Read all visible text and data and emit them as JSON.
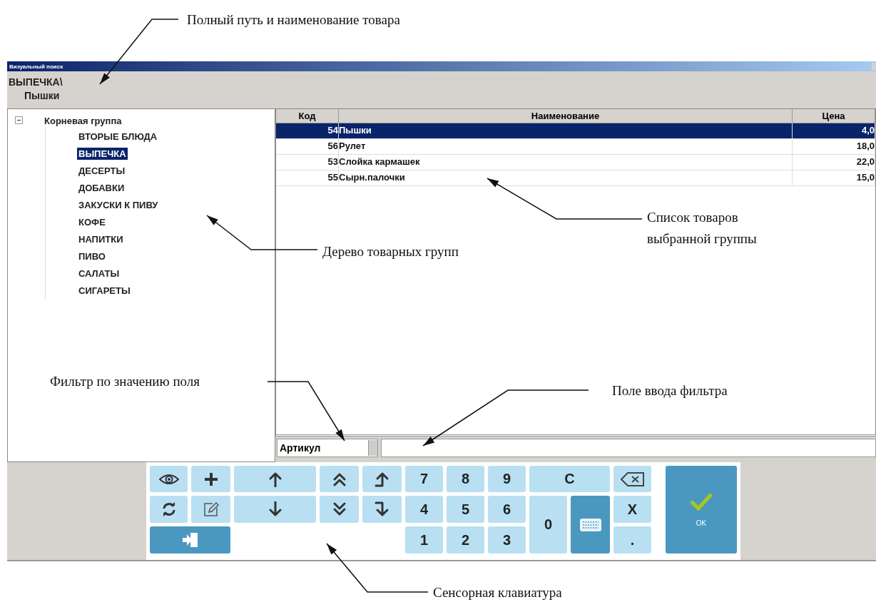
{
  "window": {
    "title": "Визуальный поиск"
  },
  "path": [
    "ВЫПЕЧКА\\",
    "Пышки"
  ],
  "tree": {
    "label": "Корневая группа",
    "expanded": true,
    "children": [
      {
        "label": "ВТОРЫЕ БЛЮДА",
        "selected": false
      },
      {
        "label": "ВЫПЕЧКА",
        "selected": true
      },
      {
        "label": "ДЕСЕРТЫ",
        "selected": false
      },
      {
        "label": "ДОБАВКИ",
        "selected": false
      },
      {
        "label": "ЗАКУСКИ К ПИВУ",
        "selected": false
      },
      {
        "label": "КОФЕ",
        "selected": false
      },
      {
        "label": "НАПИТКИ",
        "selected": false
      },
      {
        "label": "ПИВО",
        "selected": false
      },
      {
        "label": "САЛАТЫ",
        "selected": false
      },
      {
        "label": "СИГАРЕТЫ",
        "selected": false
      }
    ]
  },
  "table": {
    "columns": [
      "Код",
      "Наименование",
      "Цена"
    ],
    "rows": [
      {
        "cells": [
          "54",
          "Пышки",
          "4,0"
        ],
        "selected": true
      },
      {
        "cells": [
          "56",
          "Рулет",
          "18,0"
        ],
        "selected": false
      },
      {
        "cells": [
          "53",
          "Слойка кармашек",
          "22,0"
        ],
        "selected": false
      },
      {
        "cells": [
          "55",
          "Сырн.палочки",
          "15,0"
        ],
        "selected": false
      }
    ]
  },
  "filter": {
    "field": "Артикул"
  },
  "keypad": [
    {
      "kind": "eye",
      "accent": false
    },
    {
      "kind": "plus",
      "accent": false
    },
    {
      "kind": "up",
      "accent": false
    },
    {
      "kind": "page-up",
      "accent": false
    },
    {
      "kind": "turn-up",
      "accent": false
    },
    {
      "kind": "text",
      "label": "7",
      "accent": false
    },
    {
      "kind": "text",
      "label": "8",
      "accent": false
    },
    {
      "kind": "text",
      "label": "9",
      "accent": false
    },
    {
      "kind": "text",
      "label": "C",
      "accent": false
    },
    {
      "kind": "backspace",
      "accent": false
    },
    {
      "kind": "confirm",
      "label": "OK",
      "accent": true
    },
    {
      "kind": "refresh",
      "accent": false
    },
    {
      "kind": "edit",
      "accent": false
    },
    {
      "kind": "down",
      "accent": false
    },
    {
      "kind": "page-down",
      "accent": false
    },
    {
      "kind": "turn-down",
      "accent": false
    },
    {
      "kind": "text",
      "label": "4",
      "accent": false
    },
    {
      "kind": "text",
      "label": "5",
      "accent": false
    },
    {
      "kind": "text",
      "label": "6",
      "accent": false
    },
    {
      "kind": "text",
      "label": "0",
      "accent": false
    },
    {
      "kind": "keyboard",
      "accent": true
    },
    {
      "kind": "text",
      "label": "X",
      "accent": false
    },
    {
      "kind": "exit",
      "accent": true
    },
    {
      "kind": "text",
      "label": "1",
      "accent": false
    },
    {
      "kind": "text",
      "label": "2",
      "accent": false
    },
    {
      "kind": "text",
      "label": "3",
      "accent": false
    },
    {
      "kind": "text",
      "label": ".",
      "accent": false
    }
  ],
  "annotations": [
    {
      "text": "Полный путь и наименование товара"
    },
    {
      "text": "Список товаров\nвыбранной группы"
    },
    {
      "text": "Дерево товарных групп"
    },
    {
      "text": "Фильтр по значению поля"
    },
    {
      "text": "Поле ввода фильтра"
    },
    {
      "text": "Сенсорная клавиатура"
    }
  ]
}
